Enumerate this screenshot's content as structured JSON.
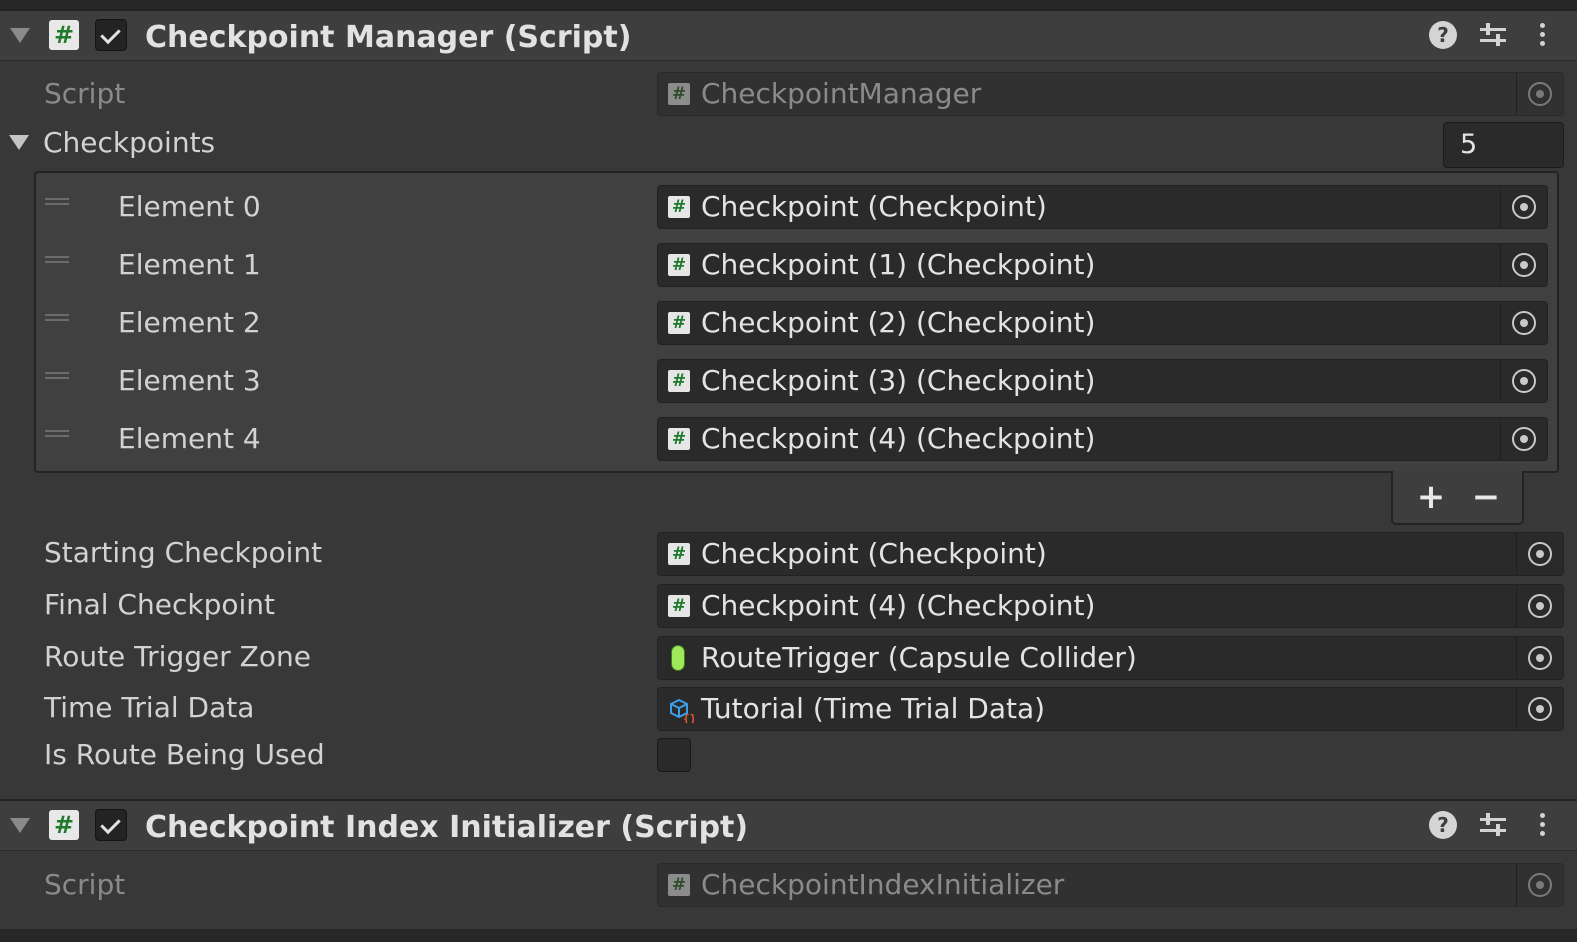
{
  "components": [
    {
      "title": "Checkpoint Manager (Script)",
      "enabled": true,
      "header_icons": [
        "help-icon",
        "presets-icon",
        "kebab-menu-icon"
      ]
    },
    {
      "title": "Checkpoint Index Initializer (Script)",
      "enabled": true,
      "header_icons": [
        "help-icon",
        "presets-icon",
        "kebab-menu-icon"
      ]
    }
  ],
  "checkpoint_manager": {
    "script_label": "Script",
    "script_value": "CheckpointManager",
    "checkpoints_label": "Checkpoints",
    "checkpoints_count": "5",
    "elements": [
      {
        "label": "Element 0",
        "value": "Checkpoint (Checkpoint)"
      },
      {
        "label": "Element 1",
        "value": "Checkpoint (1) (Checkpoint)"
      },
      {
        "label": "Element 2",
        "value": "Checkpoint (2) (Checkpoint)"
      },
      {
        "label": "Element 3",
        "value": "Checkpoint (3) (Checkpoint)"
      },
      {
        "label": "Element 4",
        "value": "Checkpoint (4) (Checkpoint)"
      }
    ],
    "list_add": "+",
    "list_remove": "−",
    "fields": [
      {
        "label": "Starting Checkpoint",
        "value": "Checkpoint (Checkpoint)",
        "icon": "script-icon"
      },
      {
        "label": "Final Checkpoint",
        "value": "Checkpoint (4) (Checkpoint)",
        "icon": "script-icon"
      },
      {
        "label": "Route Trigger Zone",
        "value": "RouteTrigger (Capsule Collider)",
        "icon": "capsule-collider-icon"
      },
      {
        "label": "Time Trial Data",
        "value": "Tutorial (Time Trial Data)",
        "icon": "scriptable-object-icon"
      }
    ],
    "is_route_label": "Is Route Being Used",
    "is_route_checked": false
  },
  "checkpoint_index_initializer": {
    "script_label": "Script",
    "script_value": "CheckpointIndexInitializer"
  },
  "colors": {
    "background": "#383838",
    "header": "#3e3e3e",
    "field": "#2a2a2a",
    "script_icon_green": "#1f7a2e",
    "capsule_green": "#9ee85a"
  }
}
